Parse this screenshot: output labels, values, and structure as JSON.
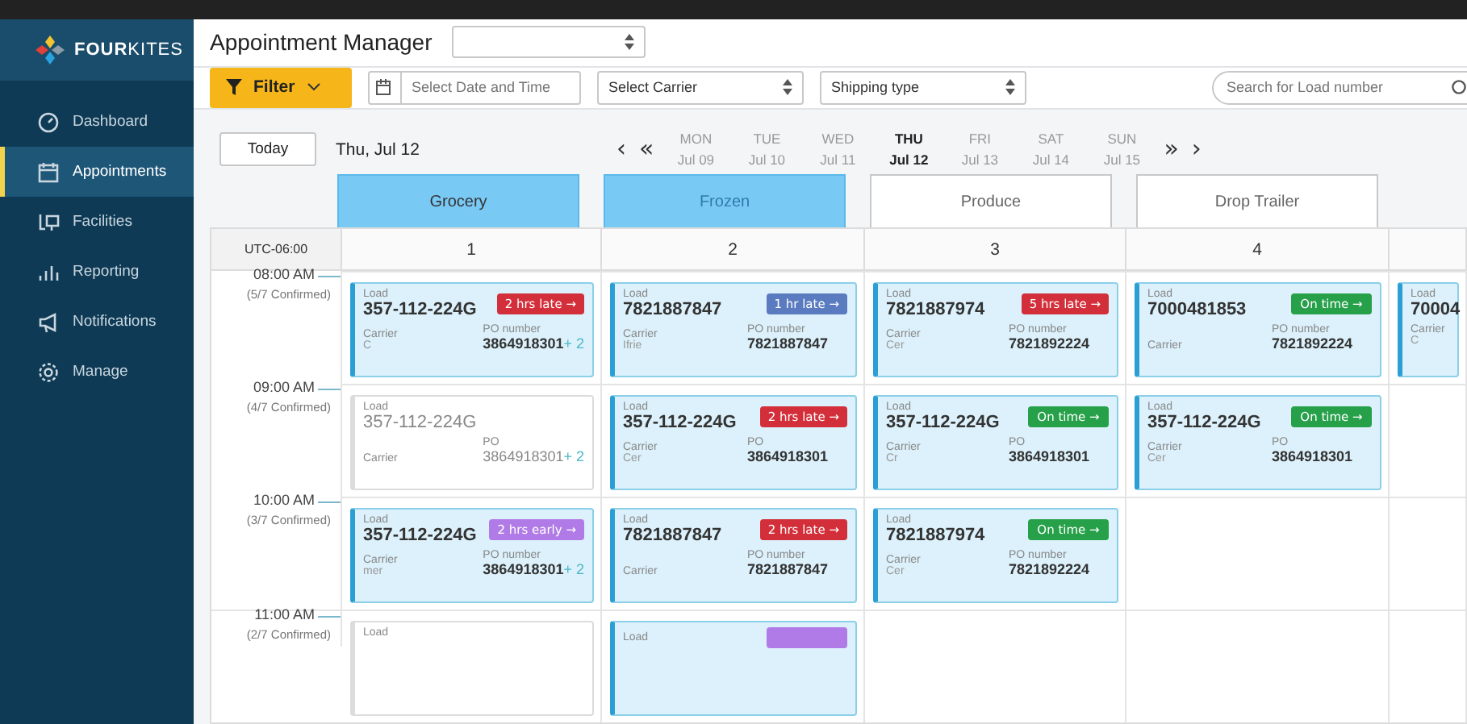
{
  "sidebar": {
    "brand": "**FOUR**KITES",
    "items": [
      {
        "label": "Dashboard",
        "selected": false
      },
      {
        "label": "Appointments",
        "selected": true
      },
      {
        "label": "Facilities",
        "selected": false
      },
      {
        "label": "Reporting",
        "selected": false
      },
      {
        "label": "Notifications",
        "selected": false
      },
      {
        "label": "Manage",
        "selected": false
      }
    ]
  },
  "header": {
    "title": "Appointment Manager"
  },
  "filters": {
    "filter_button": "Filter",
    "date_field": {
      "placeholder": "Select Date and Time"
    },
    "carrier_select": {
      "value": "Select Carrier"
    },
    "shipping_select": {
      "value": "Shipping type"
    },
    "search": {
      "placeholder": "Search for Load number"
    }
  },
  "date_nav": {
    "today": "Today",
    "current": "Thu, Jul 12",
    "prev": "‹",
    "prev_week": "«",
    "next_week": "»",
    "next": "›",
    "days": [
      {
        "day": "MON",
        "date": "Jul 09",
        "selected": false
      },
      {
        "day": "TUE",
        "date": "Jul 10",
        "selected": false
      },
      {
        "day": "WED",
        "date": "Jul 11",
        "selected": false
      },
      {
        "day": "THU",
        "date": "Jul 12",
        "selected": true
      },
      {
        "day": "FRI",
        "date": "Jul 13",
        "selected": false
      },
      {
        "day": "SAT",
        "date": "Jul 14",
        "selected": false
      },
      {
        "day": "SUN",
        "date": "Jul 15",
        "selected": false
      }
    ]
  },
  "tabs": [
    {
      "label": "Grocery",
      "selected": true,
      "disabled": false
    },
    {
      "label": "Frozen",
      "selected": true,
      "disabled": true
    },
    {
      "label": "Produce",
      "selected": false,
      "disabled": false
    },
    {
      "label": "Drop Trailer",
      "selected": false,
      "disabled": false
    }
  ],
  "schedule": {
    "timezone": "UTC-06:00",
    "columns": [
      "1",
      "2",
      "3",
      "4"
    ],
    "slots": [
      {
        "time": "08:00 AM",
        "confirmed": "(5/7 Confirmed)",
        "cards": [
          {
            "kind": "active",
            "load_label": "Load",
            "load": "357-112-224G",
            "badge": {
              "label": "2 hrs late →",
              "color": "#d32f3a"
            },
            "carrier_label": "Carrier",
            "carrier": "C",
            "po_label": "PO number",
            "po": "3864918301",
            "extra": "+ 2"
          },
          {
            "kind": "active",
            "load_label": "Load",
            "load": "7821887847",
            "badge": {
              "label": "1 hr late →",
              "color": "#5a7bbf"
            },
            "carrier_label": "Carrier",
            "carrier": "Ifrie",
            "po_label": "PO number",
            "po": "7821887847"
          },
          {
            "kind": "active",
            "load_label": "Load",
            "load": "7821887974",
            "badge": {
              "label": "5 hrs late →",
              "color": "#d32f3a"
            },
            "carrier_label": "Carrier",
            "carrier": "Cer",
            "po_label": "PO number",
            "po": "7821892224"
          },
          {
            "kind": "active",
            "load_label": "Load",
            "load": "7000481853",
            "badge": {
              "label": "On time →",
              "color": "#27a04a"
            },
            "carrier_label": "Carrier",
            "po_label": "PO number",
            "po": "7821892224"
          },
          {
            "kind": "active",
            "load_label": "Load",
            "load": "70004",
            "carrier_label": "Carrier",
            "carrier": "C"
          }
        ]
      },
      {
        "time": "09:00 AM",
        "confirmed": "(4/7 Confirmed)",
        "cards": [
          {
            "kind": "faded",
            "load_label": "Load",
            "load": "357-112-224G",
            "carrier_label": "Carrier",
            "po_label": "PO",
            "po": "3864918301",
            "extra": "+ 2"
          },
          {
            "kind": "active",
            "load_label": "Load",
            "load": "357-112-224G",
            "badge": {
              "label": "2 hrs late →",
              "color": "#d32f3a"
            },
            "carrier_label": "Carrier",
            "carrier": "Cer",
            "po_label": "PO",
            "po": "3864918301"
          },
          {
            "kind": "active",
            "load_label": "Load",
            "load": "357-112-224G",
            "badge": {
              "label": "On time →",
              "color": "#27a04a"
            },
            "carrier_label": "Carrier",
            "carrier": "Cr",
            "po_label": "PO",
            "po": "3864918301"
          },
          {
            "kind": "active",
            "load_label": "Load",
            "load": "357-112-224G",
            "badge": {
              "label": "On time →",
              "color": "#27a04a"
            },
            "carrier_label": "Carrier",
            "carrier": "Cer",
            "po_label": "PO",
            "po": "3864918301"
          }
        ]
      },
      {
        "time": "10:00 AM",
        "confirmed": "(3/7 Confirmed)",
        "cards": [
          {
            "kind": "active",
            "load_label": "Load",
            "load": "357-112-224G",
            "badge": {
              "label": "2 hrs early →",
              "color": "#b07be6"
            },
            "carrier_label": "Carrier",
            "carrier": "mer",
            "po_label": "PO number",
            "po": "3864918301",
            "extra": "+ 2"
          },
          {
            "kind": "active",
            "load_label": "Load",
            "load": "7821887847",
            "badge": {
              "label": "2 hrs late →",
              "color": "#d32f3a"
            },
            "carrier_label": "Carrier",
            "po_label": "PO number",
            "po": "7821887847"
          },
          {
            "kind": "active",
            "load_label": "Load",
            "load": "7821887974",
            "badge": {
              "label": "On time →",
              "color": "#27a04a"
            },
            "carrier_label": "Carrier",
            "carrier": "Cer",
            "po_label": "PO number",
            "po": "7821892224"
          }
        ]
      },
      {
        "time": "11:00 AM",
        "confirmed": "(2/7 Confirmed)",
        "cards": [
          {
            "kind": "faded",
            "load_label": "Load"
          },
          {
            "kind": "active",
            "load_label": "Load",
            "badge": {
              "color": "#b07be6"
            }
          }
        ]
      }
    ]
  }
}
